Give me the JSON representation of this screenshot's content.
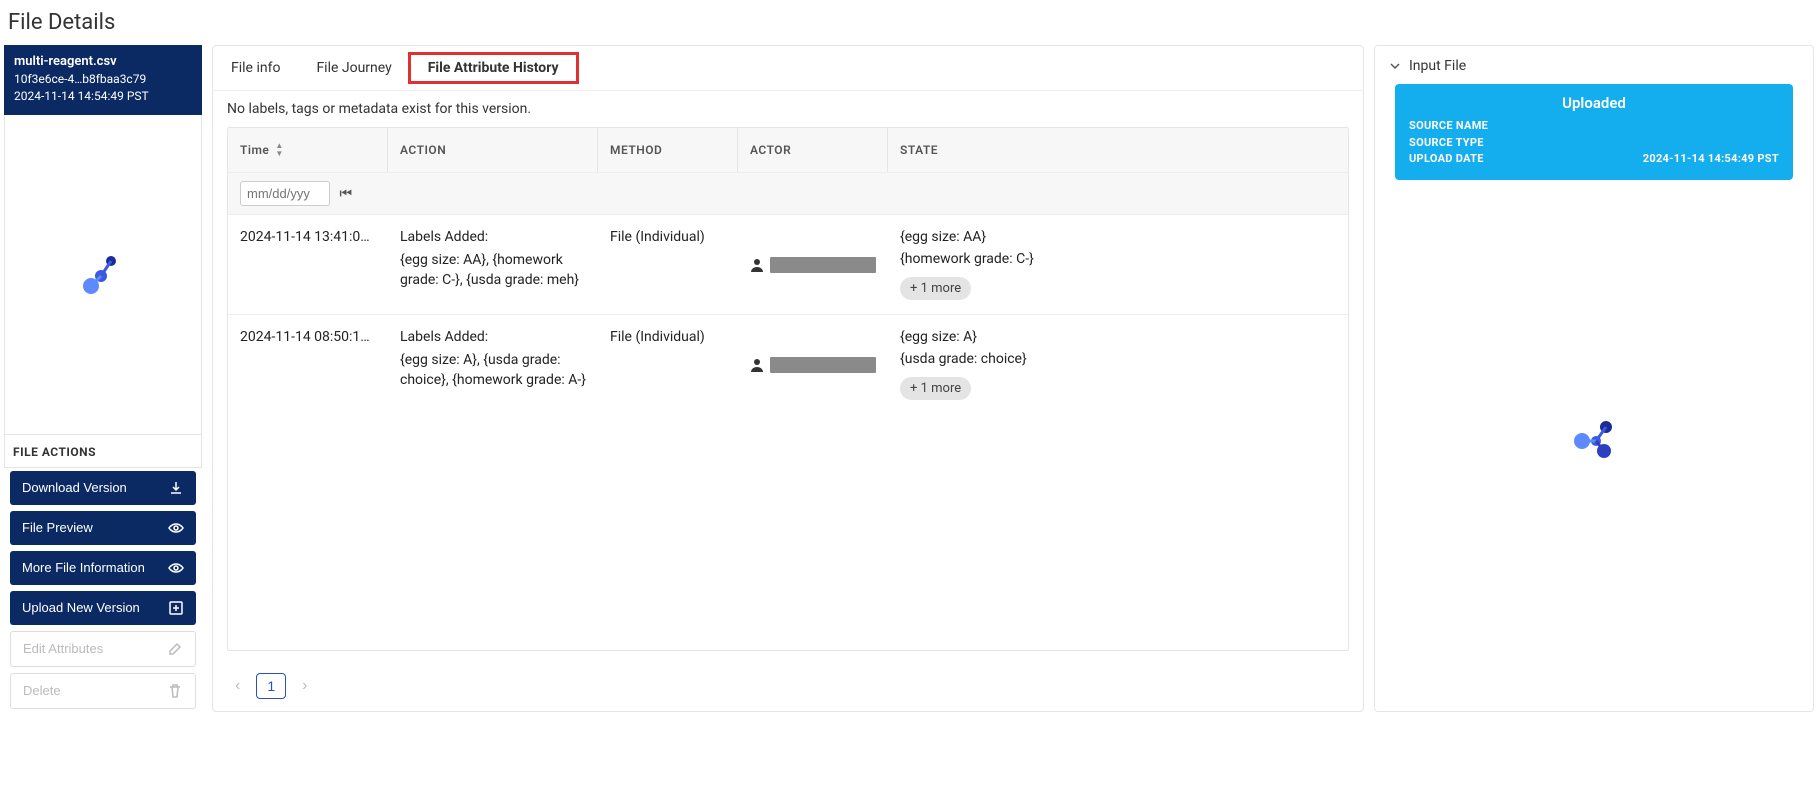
{
  "page_title": "File Details",
  "file": {
    "name": "multi-reagent.csv",
    "hash": "10f3e6ce-4…b8fbaa3c79",
    "timestamp": "2024-11-14 14:54:49 PST"
  },
  "file_actions_header": "FILE ACTIONS",
  "actions": {
    "download": "Download Version",
    "preview": "File Preview",
    "more_info": "More File Information",
    "upload": "Upload New Version",
    "edit": "Edit Attributes",
    "delete": "Delete"
  },
  "tabs": {
    "info": "File info",
    "journey": "File Journey",
    "history": "File Attribute History"
  },
  "notice": "No labels, tags or metadata exist for this version.",
  "columns": {
    "time": "Time",
    "action": "ACTION",
    "method": "METHOD",
    "actor": "ACTOR",
    "state": "STATE"
  },
  "date_placeholder": "mm/dd/yyy",
  "rows": [
    {
      "time": "2024-11-14 13:41:0…",
      "action_title": "Labels Added:",
      "action_detail": "{egg size: AA}, {homework grade: C-}, {usda grade: meh}",
      "method": "File (Individual)",
      "state1": "{egg size: AA}",
      "state2": "{homework grade: C-}",
      "more": "+ 1 more"
    },
    {
      "time": "2024-11-14 08:50:1…",
      "action_title": "Labels Added:",
      "action_detail": "{egg size: A}, {usda grade: choice}, {homework grade: A-}",
      "method": "File (Individual)",
      "state1": "{egg size: A}",
      "state2": "{usda grade: choice}",
      "more": "+ 1 more"
    }
  ],
  "pagination": {
    "page": "1"
  },
  "right": {
    "section": "Input File",
    "uploaded": "Uploaded",
    "source_name_label": "SOURCE NAME",
    "source_type_label": "SOURCE TYPE",
    "upload_date_label": "UPLOAD DATE",
    "upload_date_value": "2024-11-14 14:54:49 PST"
  }
}
